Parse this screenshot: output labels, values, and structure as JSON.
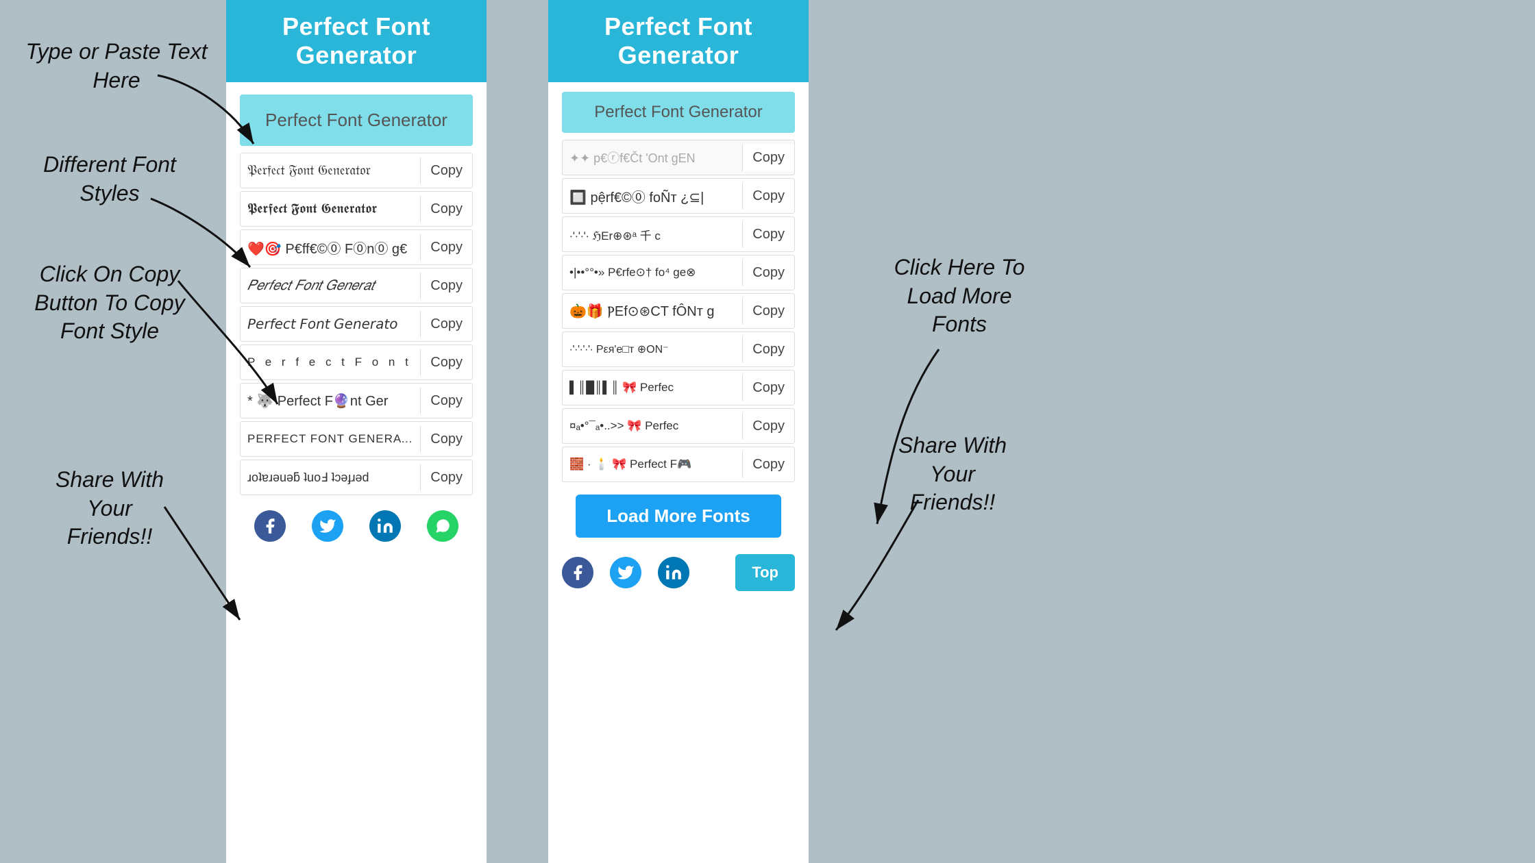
{
  "annotations": {
    "type_paste": "Type or Paste Text\nHere",
    "different_fonts": "Different Font\nStyles",
    "click_copy": "Click On Copy\nButton To Copy\nFont Style",
    "share_friends_left": "Share With\nYour\nFriends!!",
    "click_load": "Click Here To\nLoad More\nFonts",
    "share_friends_right": "Share With\nYour\nFriends!!"
  },
  "left_panel": {
    "header": "Perfect Font Generator",
    "input_placeholder": "Perfect Font Generator",
    "input_value": "Perfect Font Generator",
    "font_rows": [
      {
        "text": "𝔓𝔢𝔯𝔣𝔢𝔠𝔱 𝔉𝔬𝔫𝔱 𝔊𝔢𝔫𝔢𝔯𝔞𝔱𝔬𝔯",
        "copy": "Copy"
      },
      {
        "text": "𝕻𝖊𝖗𝖋𝖊𝖈𝖙 𝕱𝖔𝖓𝖙 𝕲𝖊𝖓𝖊𝖗𝖆𝖙𝖔𝖗",
        "copy": "Copy"
      },
      {
        "text": "❤️🎯 P€ff€©⓪ F⓪n⓪ g€",
        "copy": "Copy"
      },
      {
        "text": "𝑃𝑒𝑟𝑓𝑒𝑐𝑡 𝐹𝑜𝑛𝑡 𝐺𝑒𝑛𝑒𝑟𝑎𝑡",
        "copy": "Copy"
      },
      {
        "text": "𝘗𝘦𝘳𝘧𝘦𝘤𝘵 𝘍𝘰𝘯𝘵 𝘎𝘦𝘯𝘦𝘳𝘢𝘵𝘰",
        "copy": "Copy"
      },
      {
        "text": "P e r f e c t  F o n t",
        "copy": "Copy",
        "style": "spaced"
      },
      {
        "text": "* 🐺 Perfect F🔮nt Ger",
        "copy": "Copy"
      },
      {
        "text": "PERFECT FONT GENERATOR",
        "copy": "Copy",
        "style": "caps"
      },
      {
        "text": "ɹoʇɐɹǝuǝƃ ʇuoℲ ʇɔǝɟɹǝd",
        "copy": "Copy",
        "style": "flip"
      }
    ],
    "social": {
      "facebook": "Facebook",
      "twitter": "Twitter",
      "linkedin": "LinkedIn",
      "whatsapp": "WhatsApp"
    }
  },
  "right_panel": {
    "header": "Perfect Font Generator",
    "input_placeholder": "Perfect Font Generator",
    "input_value": "Perfect Font Generator",
    "font_rows": [
      {
        "text": "🐾🌹 p€rf€Čt 'Ont gEN",
        "copy": "Copy"
      },
      {
        "text": "$ 🔲 p@rFE©⓪ foÑт ¿⊆|",
        "copy": "Copy"
      },
      {
        "text": "∙'∙'∙'∙  ℌEr⊕⊛ᵃ 千 c",
        "copy": "Copy"
      },
      {
        "text": "•|••°°•»  Ρ€rfе⊙† fo⁴ ge⊗",
        "copy": "Copy"
      },
      {
        "text": "🎃🎁 ⲢEf⊙⊛CT fÔNт g",
        "copy": "Copy"
      },
      {
        "text": "∙'∙'∙'∙'∙  Ρεя'е□т ⊕ON⁻",
        "copy": "Copy"
      },
      {
        "text": "▌║█║ 🎀 Perfec",
        "copy": "Copy"
      },
      {
        "text": "¤ₐ•°¯ₐ•..>>  🎀 Perfec",
        "copy": "Copy"
      },
      {
        "text": "🧱 · 🕯️ 🎀 Perfect F🎮",
        "copy": "Copy"
      }
    ],
    "load_more": "Load More Fonts",
    "top_btn": "Top",
    "social": {
      "facebook": "Facebook",
      "twitter": "Twitter",
      "linkedin": "LinkedIn"
    }
  }
}
